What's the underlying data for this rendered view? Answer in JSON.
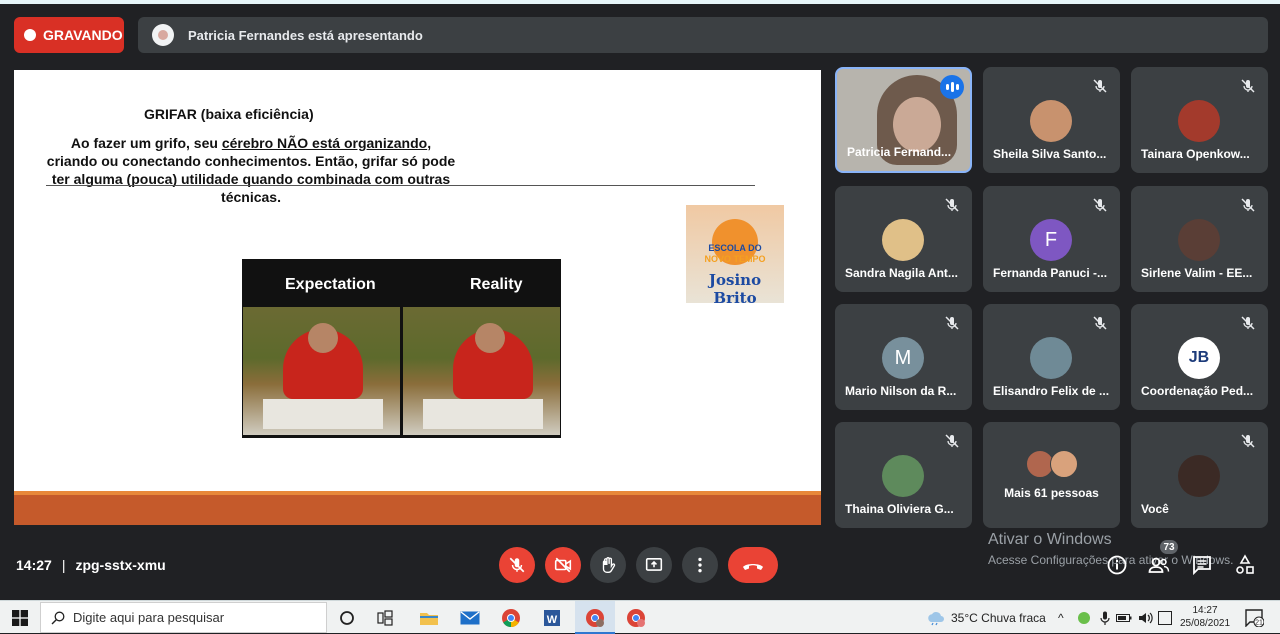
{
  "topbar": {
    "recording_label": "GRAVANDO",
    "presenting_text": "Patricia Fernandes está apresentando"
  },
  "slide": {
    "title": "GRIFAR (baixa eficiência)",
    "body_part1": "Ao fazer um grifo, seu ",
    "body_underline1": "cérebro NÃO está organizando",
    "body_part2": ", criando ou conectando conhecimentos. Então, grifar só pode ter alguma (pouca) utilidade quando combinada com outras técnicas.",
    "meme_left": "Expectation",
    "meme_right": "Reality",
    "logo_line1": "ESCOLA DO",
    "logo_line2": "NOVO TEMPO",
    "logo_line3": "Josino Brito"
  },
  "participants": [
    {
      "name": "Patricia Fernand...",
      "speaking": true
    },
    {
      "name": "Sheila Silva Santo...",
      "avatar_color": "#c8926e"
    },
    {
      "name": "Tainara Openkow...",
      "avatar_color": "#a33a2c"
    },
    {
      "name": "Sandra Nagila Ant...",
      "avatar_color": "#e0c088"
    },
    {
      "name": "Fernanda Panuci -...",
      "avatar_letter": "F",
      "avatar_color": "#7e57c2"
    },
    {
      "name": "Sirlene Valim - EE...",
      "avatar_color": "#5a3e36"
    },
    {
      "name": "Mario Nilson da R...",
      "avatar_letter": "M",
      "avatar_color": "#78909c"
    },
    {
      "name": "Elisandro Felix de ...",
      "avatar_color": "#6f8a96"
    },
    {
      "name": "Coordenação Ped...",
      "avatar_text": "JB",
      "avatar_color": "#ffffff"
    },
    {
      "name": "Thaina Oliviera G...",
      "avatar_color": "#5e8a5c"
    },
    {
      "name": "Mais 61 pessoas"
    },
    {
      "name": "Você",
      "avatar_color": "#3b2a25"
    }
  ],
  "bottom": {
    "time": "14:27",
    "separator": "|",
    "meeting_code": "zpg-sstx-xmu",
    "participants_count": "73",
    "watermark_title": "Ativar o Windows",
    "watermark_sub": "Acesse Configurações para ativar o Windows."
  },
  "taskbar": {
    "search_placeholder": "Digite aqui para pesquisar",
    "weather": "35°C  Chuva fraca",
    "time": "14:27",
    "date": "25/08/2021",
    "notifications": "21"
  }
}
